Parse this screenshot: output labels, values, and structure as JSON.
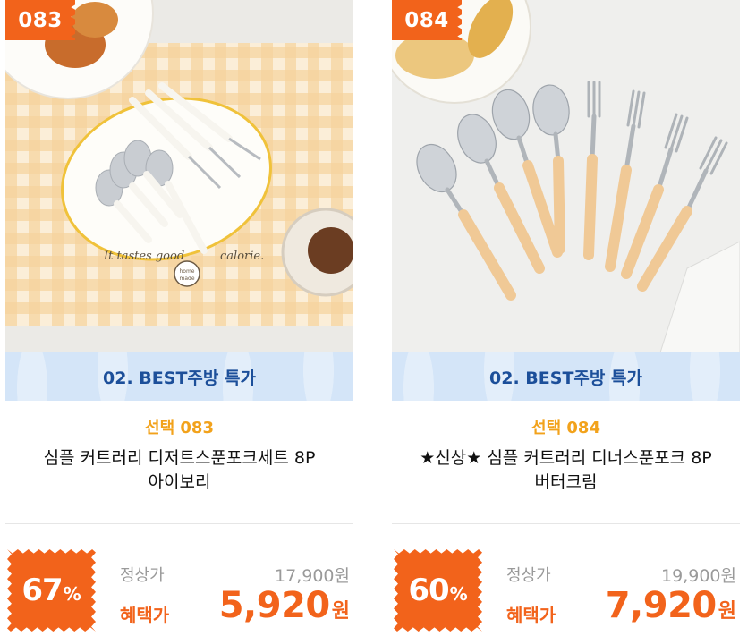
{
  "products": [
    {
      "number": "083",
      "category": "02. BEST주방 특가",
      "select_label": "선택 083",
      "name_line1": "심플 커트러리 디저트스푼포크세트 8P",
      "name_line2": "아이보리",
      "discount_num": "67",
      "discount_pct": "%",
      "regular_label": "정상가",
      "regular_price": "17,900원",
      "sale_label": "혜택가",
      "sale_price": "5,920",
      "sale_unit": "원",
      "image_text": "It tastes good … calorie.",
      "image_logo": "home made"
    },
    {
      "number": "084",
      "category": "02. BEST주방 특가",
      "select_label": "선택 084",
      "name_line1": "★신상★ 심플 커트러리 디너스푼포크 8P",
      "name_line2": "버터크림",
      "discount_num": "60",
      "discount_pct": "%",
      "regular_label": "정상가",
      "regular_price": "19,900원",
      "sale_label": "혜택가",
      "sale_price": "7,920",
      "sale_unit": "원"
    }
  ],
  "colors": {
    "accent": "#f2631b",
    "select_label": "#f2a21b",
    "category_bg": "#d4e5f8",
    "category_text": "#1c4f9a",
    "muted": "#9a9a9a"
  }
}
